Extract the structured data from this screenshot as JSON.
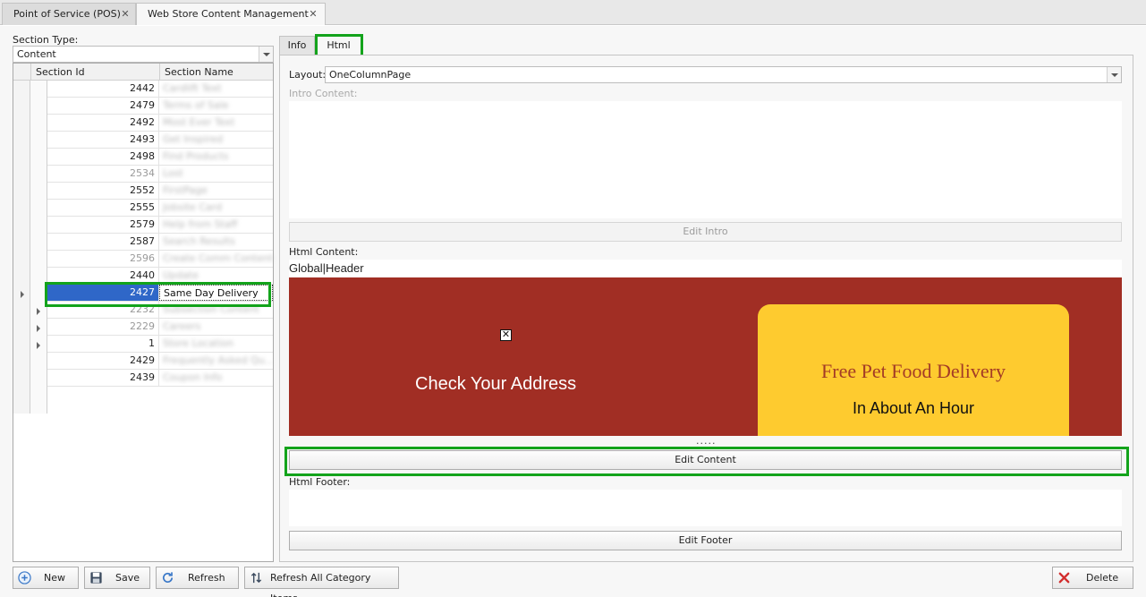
{
  "doc_tabs": [
    {
      "label": "Point of Service (POS)"
    },
    {
      "label": "Web Store Content Management"
    }
  ],
  "left": {
    "section_type_label": "Section Type:",
    "section_type_value": "Content",
    "columns": [
      "Section Id",
      "Section Name"
    ],
    "rows": [
      {
        "id": "2442",
        "name": "Cardlift Text"
      },
      {
        "id": "2479",
        "name": "Terms of Sale"
      },
      {
        "id": "2492",
        "name": "Most Ever Text"
      },
      {
        "id": "2493",
        "name": "Get Inspired"
      },
      {
        "id": "2498",
        "name": "Find Products"
      },
      {
        "id": "2534",
        "name": "Lost"
      },
      {
        "id": "2552",
        "name": "FirstPage"
      },
      {
        "id": "2555",
        "name": "Jobsite Card"
      },
      {
        "id": "2579",
        "name": "Help from Staff"
      },
      {
        "id": "2587",
        "name": "Search Results"
      },
      {
        "id": "2596",
        "name": "Create Comm Content"
      },
      {
        "id": "2440",
        "name": "Update"
      },
      {
        "id": "2427",
        "name": "Same Day Delivery"
      },
      {
        "id": "2232",
        "name": "Subsection Content"
      },
      {
        "id": "2229",
        "name": "Careers"
      },
      {
        "id": "1",
        "name": "Store Location"
      },
      {
        "id": "2429",
        "name": "Frequently Asked Qu..."
      },
      {
        "id": "2439",
        "name": "Coupon Info"
      }
    ]
  },
  "right": {
    "tabs": [
      {
        "label": "Info"
      },
      {
        "label": "Html"
      }
    ],
    "layout_label": "Layout:",
    "layout_value": "OneColumnPage",
    "intro_label": "Intro Content:",
    "edit_intro": "Edit Intro",
    "html_content_label": "Html Content:",
    "global_header": "Global|Header",
    "banner_check": "Check Your Address",
    "banner_card_title": "Free Pet Food Delivery",
    "banner_card_sub": "In About An Hour",
    "broken_image_glyph": "✕",
    "splitter_dots": ".....",
    "edit_content": "Edit Content",
    "html_footer_label": "Html Footer:",
    "edit_footer": "Edit Footer"
  },
  "bottom_buttons": {
    "new": "New",
    "save": "Save",
    "refresh": "Refresh",
    "refresh_all": "Refresh All Category Items",
    "delete": "Delete"
  },
  "colors": {
    "selection": "#2f67c8",
    "highlight": "#13a31b",
    "banner_bg": "#a12e24",
    "card_bg": "#fecb2f"
  }
}
